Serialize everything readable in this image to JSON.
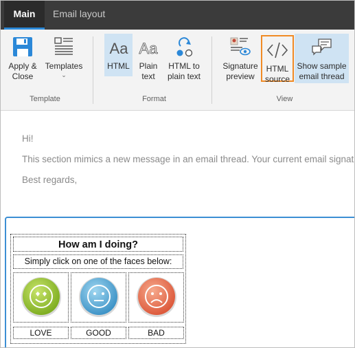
{
  "tabs": {
    "main": "Main",
    "email_layout": "Email layout"
  },
  "ribbon": {
    "template_group": {
      "label": "Template",
      "apply_close_line1": "Apply &",
      "apply_close_line2": "Close",
      "templates": "Templates"
    },
    "format_group": {
      "label": "Format",
      "html": "HTML",
      "plain_text_line1": "Plain",
      "plain_text_line2": "text",
      "html_to_plain_line1": "HTML to",
      "html_to_plain_line2": "plain text"
    },
    "view_group": {
      "label": "View",
      "signature_preview_line1": "Signature",
      "signature_preview_line2": "preview",
      "html_source_line1": "HTML",
      "html_source_line2": "source",
      "show_sample_line1": "Show sample",
      "show_sample_line2": "email thread"
    }
  },
  "preview": {
    "greeting": "Hi!",
    "body": "This section mimics a new message in an email thread. Your current email signature",
    "closing": "Best regards,"
  },
  "survey": {
    "title": "How am I doing?",
    "subtitle": "Simply click on one of the faces below:",
    "faces": [
      {
        "label": "LOVE",
        "color": "#8fbf2e"
      },
      {
        "label": "GOOD",
        "color": "#5aaad6"
      },
      {
        "label": "BAD",
        "color": "#e86a4f"
      }
    ]
  },
  "colors": {
    "accent": "#2b88d8",
    "highlight_outline": "#f08a24",
    "selected_bg": "#cfe3f3"
  }
}
